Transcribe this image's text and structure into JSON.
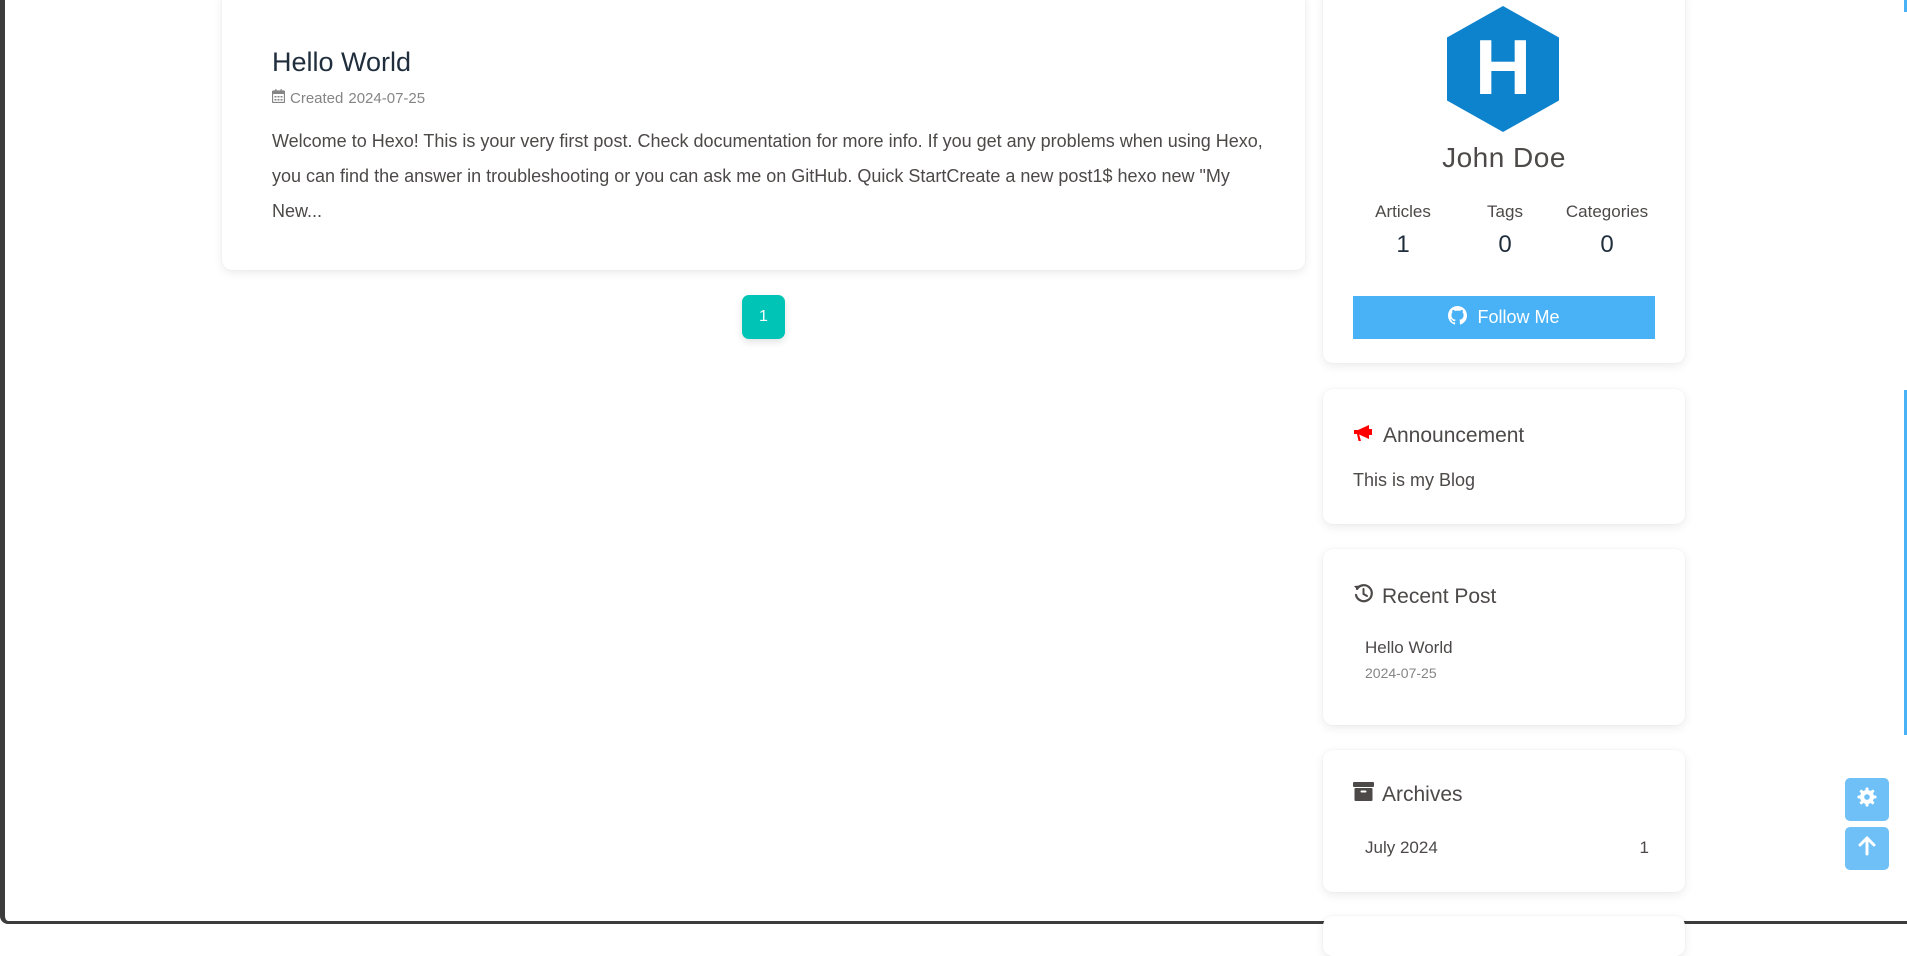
{
  "post": {
    "title": "Hello World",
    "meta_label": "Created",
    "date": "2024-07-25",
    "excerpt": "Welcome to Hexo! This is your very first post. Check documentation for more info. If you get any problems when using Hexo, you can find the answer in troubleshooting or you can ask me on GitHub. Quick StartCreate a new post1$ hexo new \"My New..."
  },
  "pagination": {
    "current": "1"
  },
  "author": {
    "avatar_letter": "H",
    "name": "John Doe",
    "stats": [
      {
        "label": "Articles",
        "value": "1"
      },
      {
        "label": "Tags",
        "value": "0"
      },
      {
        "label": "Categories",
        "value": "0"
      }
    ],
    "follow_label": "Follow Me"
  },
  "announcement": {
    "title": "Announcement",
    "text": "This is my Blog"
  },
  "recent": {
    "title": "Recent Post",
    "items": [
      {
        "title": "Hello World",
        "date": "2024-07-25"
      }
    ]
  },
  "archives": {
    "title": "Archives",
    "items": [
      {
        "label": "July 2024",
        "count": "1"
      }
    ]
  },
  "colors": {
    "accent": "#49b1f5",
    "page_button": "#00c4b6",
    "hexo_logo": "#0e83cd",
    "announcement_icon": "#ff0000"
  }
}
